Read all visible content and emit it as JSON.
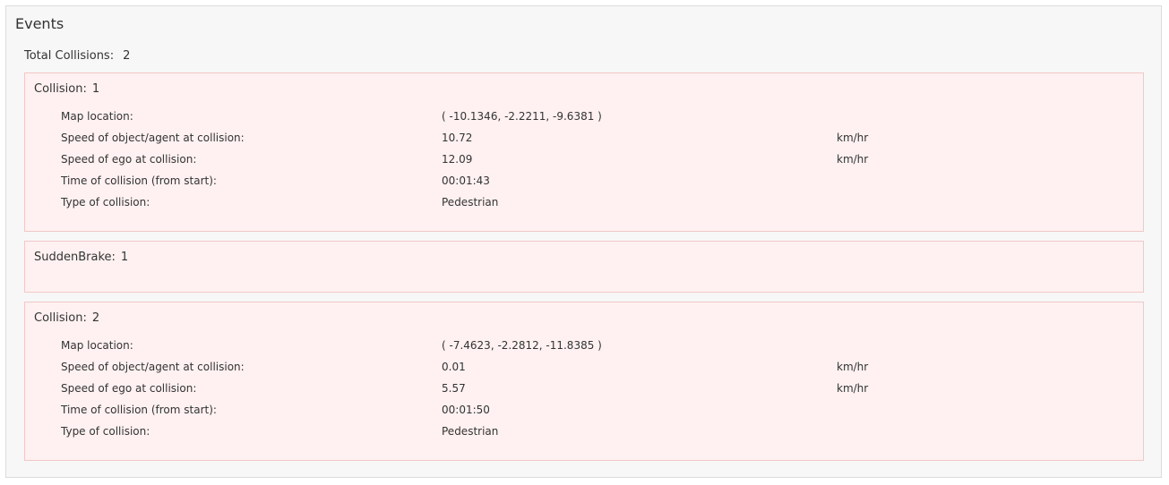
{
  "panel": {
    "title": "Events"
  },
  "total": {
    "label": "Total Collisions:",
    "value": "2"
  },
  "events": [
    {
      "name": "Collision:",
      "index": "1",
      "rows": [
        {
          "label": "Map location:",
          "value": "( -10.1346, -2.2211, -9.6381 )",
          "unit": ""
        },
        {
          "label": "Speed of object/agent at collision:",
          "value": "10.72",
          "unit": "km/hr"
        },
        {
          "label": "Speed of ego at collision:",
          "value": "12.09",
          "unit": "km/hr"
        },
        {
          "label": "Time of collision (from start):",
          "value": "00:01:43",
          "unit": ""
        },
        {
          "label": "Type of collision:",
          "value": "Pedestrian",
          "unit": ""
        }
      ]
    },
    {
      "name": "SuddenBrake:",
      "index": "1",
      "rows": []
    },
    {
      "name": "Collision:",
      "index": "2",
      "rows": [
        {
          "label": "Map location:",
          "value": "( -7.4623, -2.2812, -11.8385 )",
          "unit": ""
        },
        {
          "label": "Speed of object/agent at collision:",
          "value": "0.01",
          "unit": "km/hr"
        },
        {
          "label": "Speed of ego at collision:",
          "value": "5.57",
          "unit": "km/hr"
        },
        {
          "label": "Time of collision (from start):",
          "value": "00:01:50",
          "unit": ""
        },
        {
          "label": "Type of collision:",
          "value": "Pedestrian",
          "unit": ""
        }
      ]
    }
  ]
}
